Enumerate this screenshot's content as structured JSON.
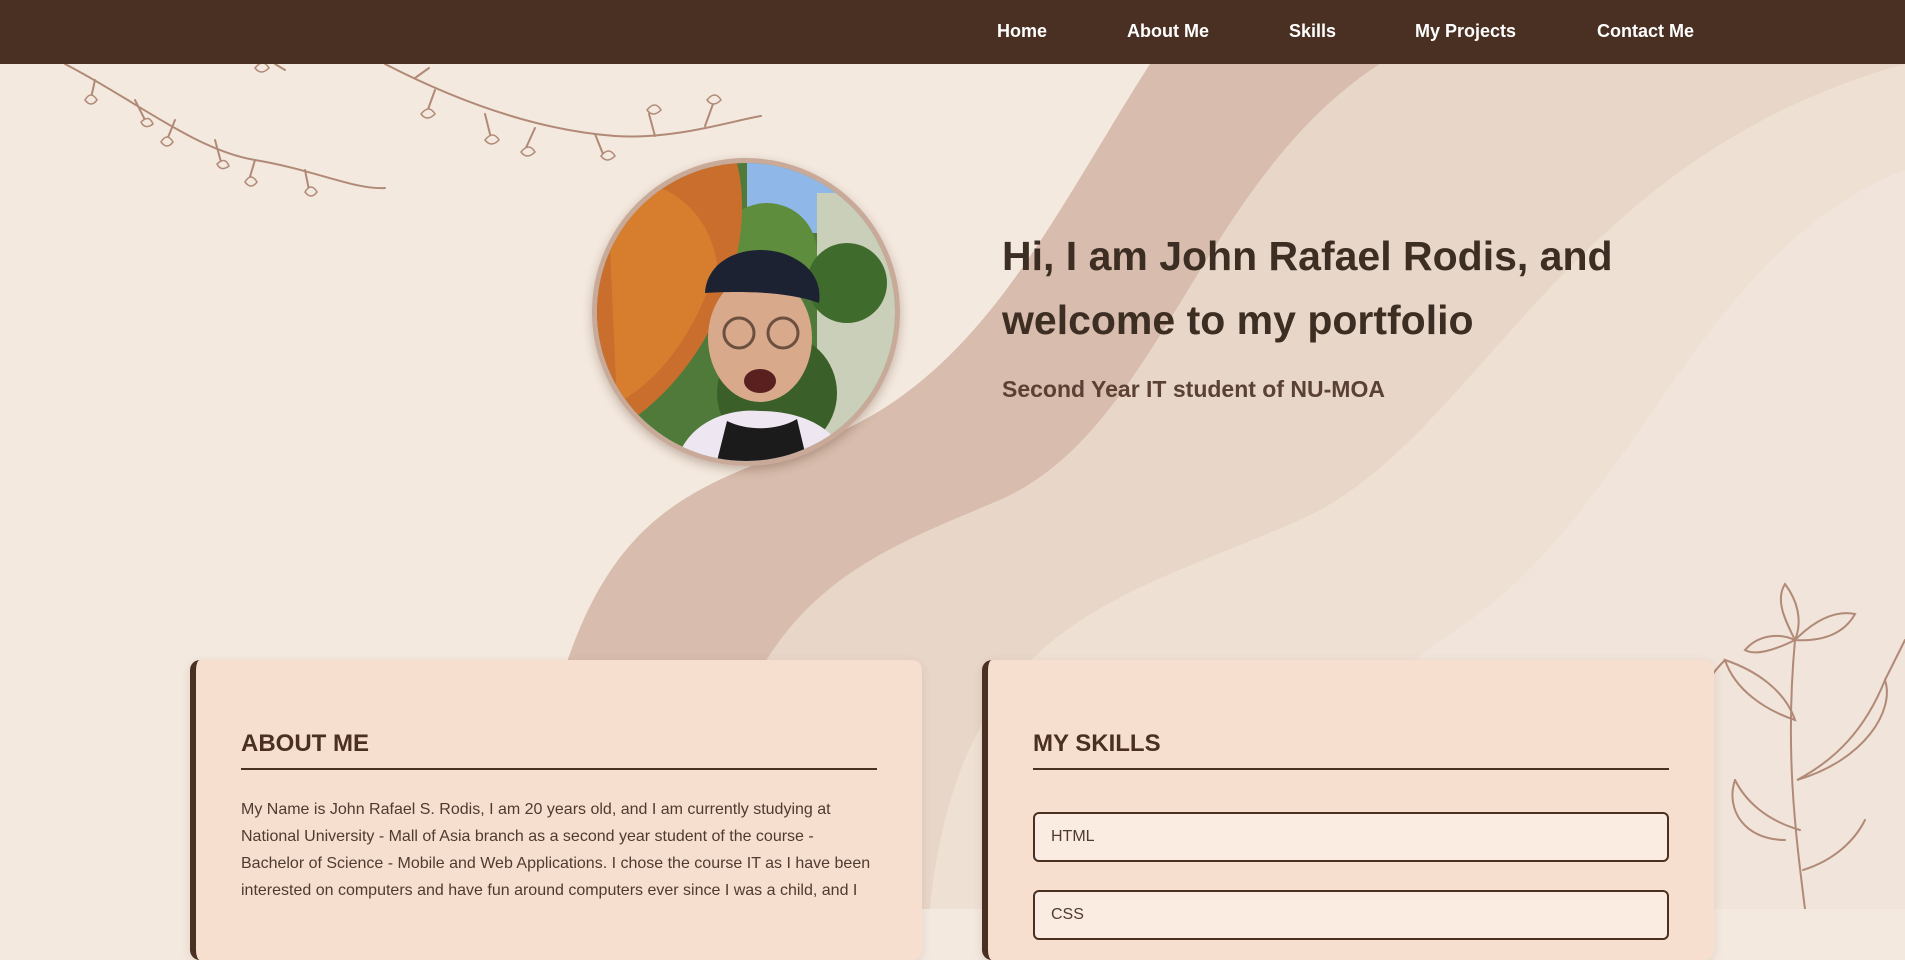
{
  "nav": {
    "items": [
      {
        "label": "Home"
      },
      {
        "label": "About Me"
      },
      {
        "label": "Skills"
      },
      {
        "label": "My Projects"
      },
      {
        "label": "Contact Me"
      }
    ]
  },
  "hero": {
    "title": "Hi, I am John Rafael Rodis, and welcome to my portfolio",
    "subtitle": "Second Year IT student of NU-MOA"
  },
  "about": {
    "heading": "ABOUT ME",
    "text": "My Name is John Rafael S. Rodis, I am 20 years old, and I am currently studying at National University - Mall of Asia branch as a second year student of the course - Bachelor of Science - Mobile and Web Applications. I chose the course IT as I have been interested on computers and have fun around computers ever since I was a child, and I"
  },
  "skills": {
    "heading": "MY SKILLS",
    "items": [
      {
        "label": "HTML"
      },
      {
        "label": "CSS"
      }
    ]
  },
  "colors": {
    "navbar": "#4a3022",
    "background": "#f4e9df",
    "card": "#f7dfcf",
    "accent": "#4a3022"
  }
}
